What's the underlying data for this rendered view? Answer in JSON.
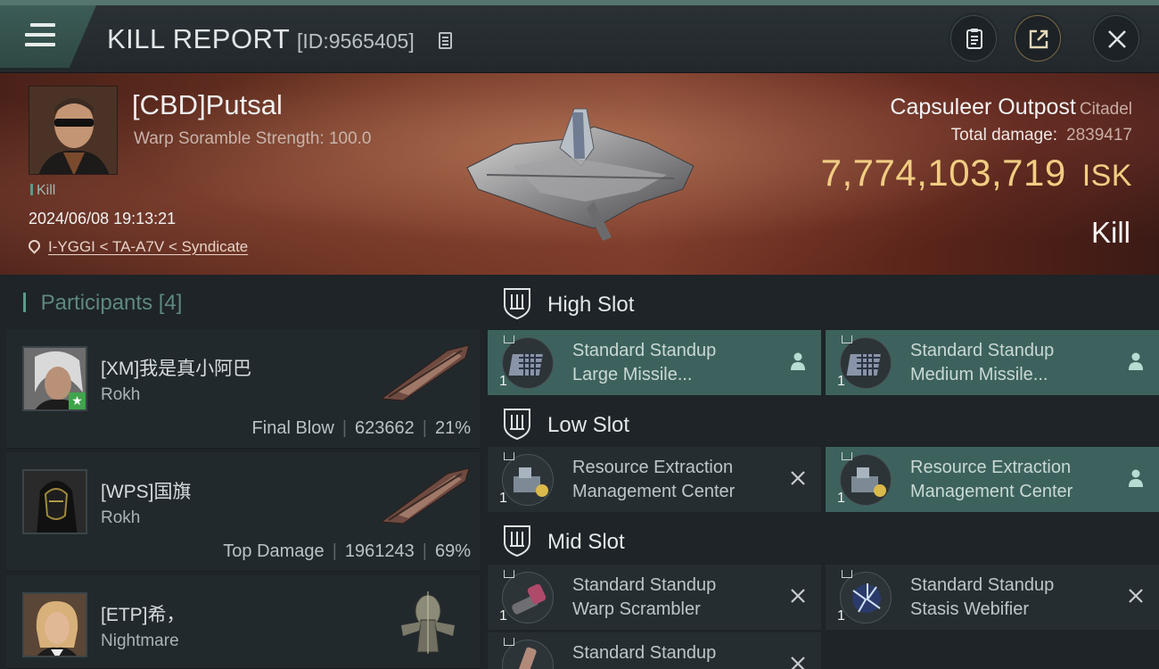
{
  "header": {
    "title": "KILL REPORT",
    "report_id": "[ID:9565405]",
    "icons": [
      "menu-icon",
      "copy-icon",
      "clipboard-icon",
      "share-icon",
      "close-icon"
    ]
  },
  "victim": {
    "name": "[CBD]Putsal",
    "subtitle": "Warp Soramble Strength: 100.0",
    "kill_tag": "Kill",
    "datetime": "2024/06/08 19:13:21",
    "location": "I-YGGI < TA-A7V < Syndicate",
    "ship": "Capsuleer Outpost",
    "ship_class": "Citadel",
    "total_damage_label": "Total damage:",
    "total_damage": "2839417",
    "isk_value": "7,774,103,719",
    "isk_unit": "ISK",
    "result": "Kill"
  },
  "participants": {
    "title": "Participants",
    "count": "[4]",
    "items": [
      {
        "name": "[XM]我是真小阿巴",
        "ship": "Rokh",
        "role": "Final Blow",
        "damage": "623662",
        "percent": "21%"
      },
      {
        "name": "[WPS]国旗",
        "ship": "Rokh",
        "role": "Top Damage",
        "damage": "1961243",
        "percent": "69%"
      },
      {
        "name": "[ETP]希，",
        "ship": "Nightmare"
      }
    ]
  },
  "fittings": {
    "high_slot": {
      "label": "High Slot",
      "modules": [
        {
          "line1": "Standard Standup",
          "line2": "Large Missile...",
          "qty": "1",
          "state": "person-icon"
        },
        {
          "line1": "Standard Standup",
          "line2": "Medium Missile...",
          "qty": "1",
          "state": "person-icon"
        }
      ]
    },
    "low_slot": {
      "label": "Low Slot",
      "modules": [
        {
          "line1": "Resource Extraction",
          "line2": "Management Center",
          "qty": "1",
          "state": "close-icon"
        },
        {
          "line1": "Resource Extraction",
          "line2": "Management Center",
          "qty": "1",
          "state": "person-icon"
        }
      ]
    },
    "mid_slot": {
      "label": "Mid Slot",
      "modules": [
        {
          "line1": "Standard Standup",
          "line2": "Warp Scrambler",
          "qty": "1",
          "state": "close-icon"
        },
        {
          "line1": "Standard Standup",
          "line2": "Stasis Webifier",
          "qty": "1",
          "state": "close-icon"
        },
        {
          "line1": "Standard Standup",
          "line2": "",
          "qty": "",
          "state": "close-icon"
        }
      ]
    }
  },
  "colors": {
    "accent": "#5b9a8a",
    "isk_gold": "#f1cd82",
    "active_module": "#3d625d",
    "panel": "#22292d"
  }
}
